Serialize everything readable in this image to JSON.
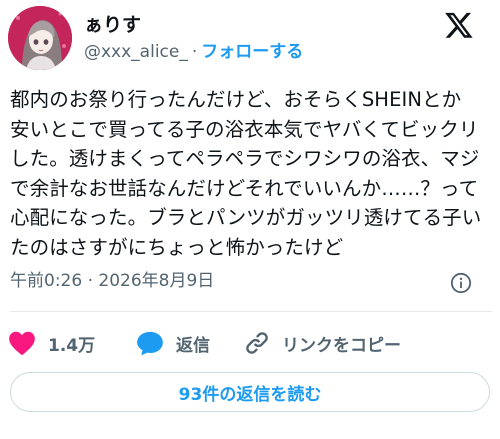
{
  "author": {
    "display_name": "ぁりす",
    "handle": "@xxx_alice_",
    "separator": "·",
    "follow_label": "フォローする"
  },
  "tweet": {
    "text": "都内のお祭り行ったんだけど、おそらくSHEINとか\n安いとこで買ってる子の浴衣本気でヤバくてビックリ\nした。透けまくってペラペラでシワシワの浴衣、マジ\nで余計なお世話なんだけどそれでいいんか……？って\n心配になった。ブラとパンツがガッツリ透けてる子い\nたのはさすがにちょっと怖かったけど",
    "timestamp": "午前0:26 · 2026年8月9日"
  },
  "actions": {
    "like_count": "1.4万",
    "reply_label": "返信",
    "copy_link_label": "リンクをコピー"
  },
  "replies_button_label": "93件の返信を読む",
  "colors": {
    "accent": "#1d9bf0",
    "like": "#f91880",
    "text": "#0f1419",
    "muted": "#536471"
  },
  "icons": [
    "x-logo-icon",
    "info-icon",
    "heart-icon",
    "reply-bubble-icon",
    "link-icon"
  ]
}
